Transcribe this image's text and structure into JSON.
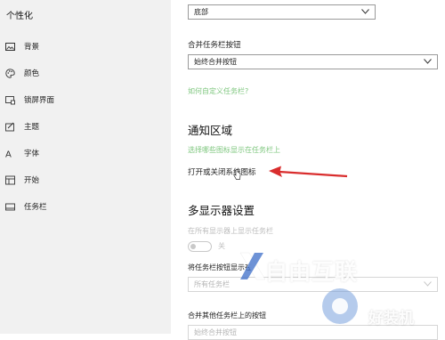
{
  "sidebar": {
    "title": "个性化",
    "items": [
      {
        "label": "背景",
        "icon": "picture-icon"
      },
      {
        "label": "颜色",
        "icon": "palette-icon"
      },
      {
        "label": "锁屏界面",
        "icon": "lock-screen-icon"
      },
      {
        "label": "主题",
        "icon": "theme-icon"
      },
      {
        "label": "字体",
        "icon": "font-icon"
      },
      {
        "label": "开始",
        "icon": "start-icon"
      },
      {
        "label": "任务栏",
        "icon": "taskbar-icon"
      }
    ]
  },
  "main": {
    "position_select_value": "底部",
    "combine_label": "合并任务栏按钮",
    "combine_select_value": "始终合并按钮",
    "customize_link": "如何自定义任务栏?",
    "notification_heading": "通知区域",
    "select_icons_link": "选择哪些图标显示在任务栏上",
    "system_icons_label": "打开或关闭系统图标",
    "multi_display_heading": "多显示器设置",
    "show_all_label": "在所有显示器上显示任务栏",
    "toggle_state": "关",
    "show_buttons_label": "将任务栏按钮显示在",
    "show_buttons_value": "所有任务栏",
    "combine_other_label": "合并其他任务栏上的按钮",
    "combine_other_value": "始终合并按钮"
  },
  "watermark": {
    "text": "自由互联",
    "text2": "好装机"
  },
  "colors": {
    "accent_arrow": "#d92d2d",
    "link_green": "#7fc77f",
    "sidebar_bg": "#f1f1f1"
  }
}
